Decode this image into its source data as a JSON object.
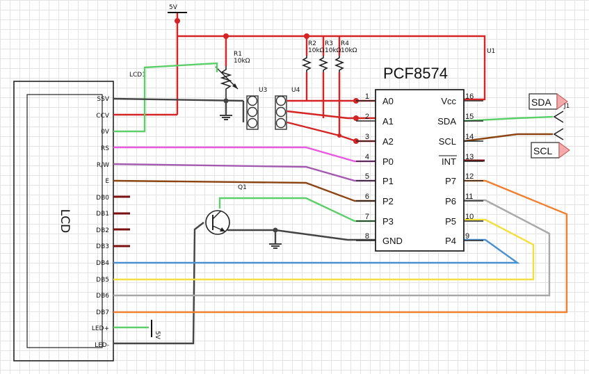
{
  "lcd": {
    "module_label": "LCD1",
    "body_label": "LCD",
    "pins": [
      "SSV",
      "CCV",
      "0V",
      "RS",
      "R/W",
      "E",
      "DB0",
      "DB1",
      "DB2",
      "DB3",
      "DB4",
      "DB5",
      "DB6",
      "DB7",
      "LED+",
      "LED-"
    ],
    "led_supply": "5V"
  },
  "power": {
    "supply_label": "5V"
  },
  "r1": {
    "name": "R1",
    "value": "10kΩ"
  },
  "pullups": [
    {
      "name": "R2",
      "value": "10kΩ"
    },
    {
      "name": "R3",
      "value": "10kΩ"
    },
    {
      "name": "R4",
      "value": "10kΩ"
    }
  ],
  "jumpers": {
    "u3": "U3",
    "u4": "U4"
  },
  "transistor": {
    "name": "Q1"
  },
  "chip": {
    "ref": "U1",
    "name": "PCF8574",
    "left_pins": [
      {
        "num": "1",
        "label": "A0"
      },
      {
        "num": "2",
        "label": "A1"
      },
      {
        "num": "3",
        "label": "A2"
      },
      {
        "num": "4",
        "label": "P0"
      },
      {
        "num": "5",
        "label": "P1"
      },
      {
        "num": "6",
        "label": "P2"
      },
      {
        "num": "7",
        "label": "P3"
      },
      {
        "num": "8",
        "label": "GND"
      }
    ],
    "right_pins": [
      {
        "num": "16",
        "label": "Vcc"
      },
      {
        "num": "15",
        "label": "SDA"
      },
      {
        "num": "14",
        "label": "SCL"
      },
      {
        "num": "13",
        "label": "INT"
      },
      {
        "num": "12",
        "label": "P7"
      },
      {
        "num": "11",
        "label": "P6"
      },
      {
        "num": "10",
        "label": "P5"
      },
      {
        "num": "9",
        "label": "P4"
      }
    ]
  },
  "connector": {
    "ref": "J1",
    "sda": "SDA",
    "scl": "SCL"
  },
  "wire_colors": {
    "supply": "#d42424",
    "ground": "#444444",
    "contrast": "#5ccf6a",
    "rs": "#e85ae0",
    "rw": "#a35bb0",
    "e": "#8b4513",
    "p3": "#5ccf6a",
    "db4": "#4a90d0",
    "db5": "#f2e040",
    "db6": "#a8a8a8",
    "db7": "#f08030",
    "sda": "#5ccf6a",
    "scl": "#8b4513",
    "unused_pin": "#7a1010"
  }
}
